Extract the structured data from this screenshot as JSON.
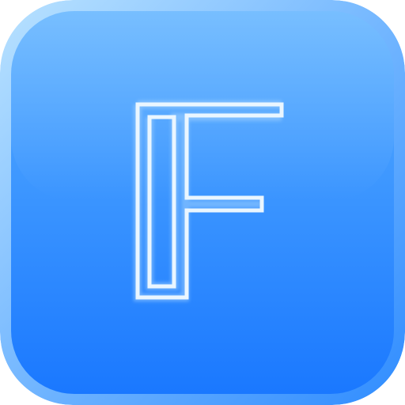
{
  "icon": {
    "semantic": "letter-f-app-icon",
    "glyph": "F",
    "colors": {
      "background_top": "#5ab0ff",
      "background_bottom": "#1a78ff",
      "frame_highlight": "#b9e2ff",
      "frame_shadow": "#2f8cff",
      "glyph_fill": "#eaf6ff",
      "glyph_edge": "#9fd0ff"
    }
  }
}
